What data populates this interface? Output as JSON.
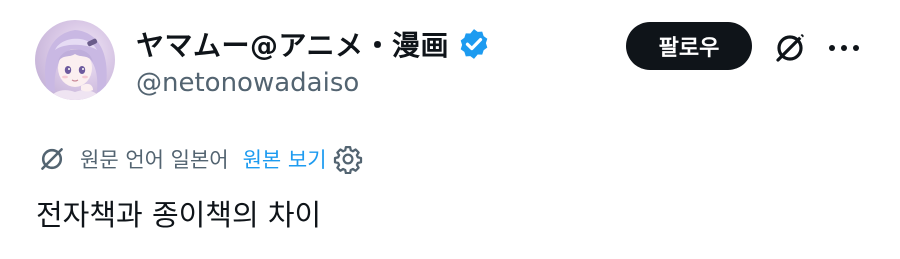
{
  "author": {
    "display_name": "ヤマムー@アニメ・漫画",
    "handle": "@netonowadaiso",
    "avatar_icon": "anime-girl-avatar",
    "verified_icon": "verified-badge-icon",
    "verified_color": "#1d9bf0"
  },
  "actions": {
    "follow_label": "팔로우",
    "grok_icon": "grok-icon",
    "more_icon": "more-icon"
  },
  "translation": {
    "source_note": "원문 언어 일본어",
    "show_original_label": "원본 보기",
    "settings_icon": "gear-icon"
  },
  "tweet": {
    "text": "전자책과 종이책의 차이"
  },
  "colors": {
    "text_primary": "#0f1419",
    "text_secondary": "#536471",
    "link": "#1d9bf0",
    "follow_bg": "#0f1419"
  }
}
